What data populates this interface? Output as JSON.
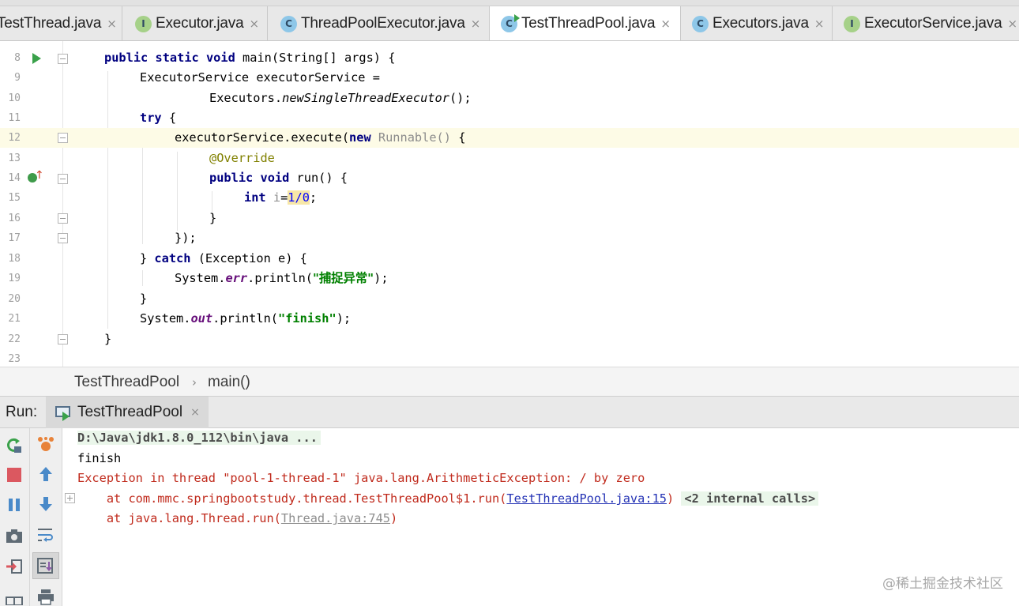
{
  "tabs": [
    {
      "label": "TestThread.java",
      "icon": "class-icon",
      "active": false
    },
    {
      "label": "Executor.java",
      "icon": "interface-icon",
      "active": false
    },
    {
      "label": "ThreadPoolExecutor.java",
      "icon": "class-icon",
      "active": false
    },
    {
      "label": "TestThreadPool.java",
      "icon": "runnable-class-icon",
      "active": true
    },
    {
      "label": "Executors.java",
      "icon": "class-icon",
      "active": false
    },
    {
      "label": "ExecutorService.java",
      "icon": "interface-icon",
      "active": false
    }
  ],
  "tab_icon_letters": {
    "class": "C",
    "interface": "I"
  },
  "tab_close_glyph": "×",
  "editor": {
    "line_numbers": [
      "8",
      "9",
      "10",
      "11",
      "12",
      "13",
      "14",
      "15",
      "16",
      "17",
      "18",
      "19",
      "20",
      "21",
      "22",
      "23"
    ],
    "code": {
      "l8": {
        "kw1": "public",
        "kw2": "static",
        "kw3": "void",
        "rest": " main(String[] args) {"
      },
      "l9": {
        "text": "ExecutorService executorService ="
      },
      "l10": {
        "pre": "Executors.",
        "method": "newSingleThreadExecutor",
        "post": "();"
      },
      "l11": {
        "kw": "try",
        "rest": " {"
      },
      "l12": {
        "pre": "executorService.execute(",
        "kw": "new",
        "anon": " Runnable()",
        "post": " {"
      },
      "l13": {
        "ann": "@Override"
      },
      "l14": {
        "kw1": "public",
        "kw2": "void",
        "rest": " run() {"
      },
      "l15": {
        "kw": "int",
        "var": " i",
        "op": "=",
        "num": "1/0",
        "post": ";"
      },
      "l16": {
        "text": "}"
      },
      "l17": {
        "text": "});"
      },
      "l18": {
        "pre": "} ",
        "kw": "catch",
        "rest": " (Exception e) {"
      },
      "l19": {
        "pre": "System.",
        "field": "err",
        "mid": ".println(",
        "str": "\"捕捉异常\"",
        "post": ");"
      },
      "l20": {
        "text": "}"
      },
      "l21": {
        "pre": "System.",
        "field": "out",
        "mid": ".println(",
        "str": "\"finish\"",
        "post": ");"
      },
      "l22": {
        "text": "}"
      }
    }
  },
  "breadcrumb": {
    "class_name": "TestThreadPool",
    "separator": "›",
    "method": "main()"
  },
  "run": {
    "label": "Run:",
    "tab_label": "TestThreadPool",
    "close_glyph": "×"
  },
  "console": {
    "command": "D:\\Java\\jdk1.8.0_112\\bin\\java ...",
    "output": "finish",
    "exception": "Exception in thread \"pool-1-thread-1\" java.lang.ArithmeticException: / by zero",
    "trace1": {
      "prefix": "    at com.mmc.springbootstudy.thread.TestThreadPool$1.run(",
      "link": "TestThreadPool.java:15",
      "suffix": ")",
      "internal": "<2 internal calls>"
    },
    "trace2": {
      "prefix": "    at java.lang.Thread.run(",
      "link": "Thread.java:745",
      "suffix": ")"
    }
  },
  "watermark": "@稀土掘金技术社区",
  "colors": {
    "keyword": "#000080",
    "string": "#008000",
    "error": "#c02a1c",
    "link": "#2433b5",
    "current_line": "#fdfbe6"
  }
}
